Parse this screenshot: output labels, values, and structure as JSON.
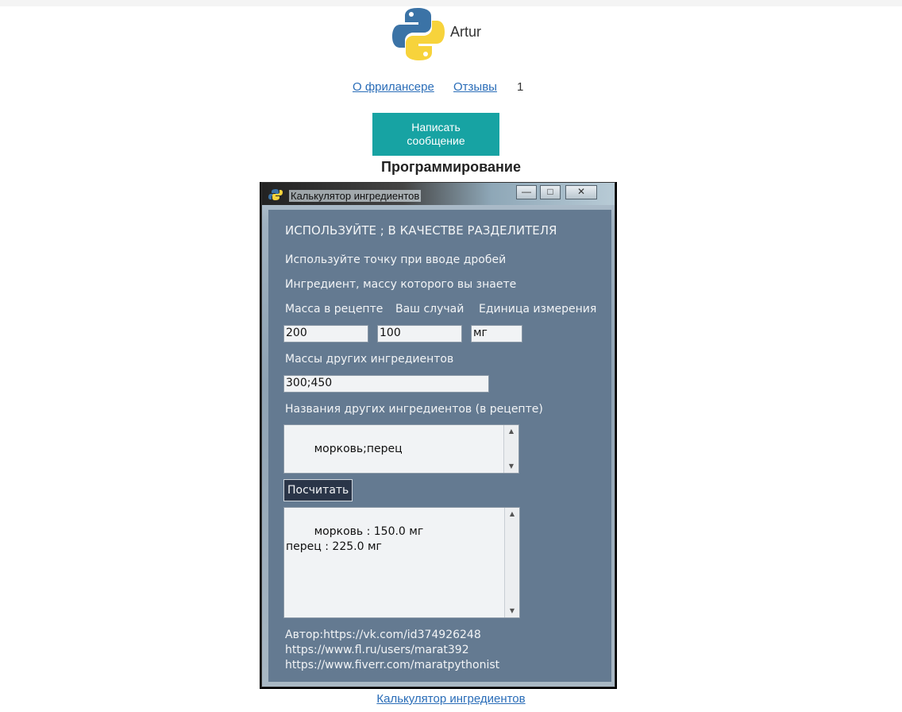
{
  "profile": {
    "name": "Artur",
    "logo_icon": "python-logo-icon"
  },
  "nav": {
    "about": "О фрилансере",
    "reviews": "Отзывы",
    "reviews_count": "1"
  },
  "message_button": "Написать сообщение",
  "section_title": "Программирование",
  "app": {
    "window_title": "Калькулятор ингредиентов",
    "controls": {
      "minimize": "—",
      "maximize": "□",
      "close": "✕"
    },
    "heading": "ИСПОЛЬЗУЙТЕ ; В КАЧЕСТВЕ РАЗДЕЛИТЕЛЯ",
    "hint_decimal": "Используйте точку при вводе дробей",
    "hint_known": "Ингредиент, массу которого вы знаете",
    "col_recipe": "Масса в рецепте",
    "col_case": "Ваш случай",
    "col_unit": "Единица измерения",
    "recipe_mass": "200",
    "your_mass": "100",
    "unit": "мг",
    "other_masses_label": "Массы других ингредиентов",
    "other_masses": "300;450",
    "other_names_label": "Названия других ингредиентов (в рецепте)",
    "other_names": "морковь;перец",
    "calc_button": "Посчитать",
    "result": "морковь : 150.0 мг\nперец : 225.0 мг",
    "author_line1": "Автор:https://vk.com/id374926248",
    "author_line2": "https://www.fl.ru/users/marat392",
    "author_line3": "https://www.fiverr.com/maratpythonist"
  },
  "caption_link": "Калькулятор ингредиентов",
  "colors": {
    "accent_button": "#17a3a3",
    "link": "#2a6db8",
    "app_bg": "#647a91"
  }
}
